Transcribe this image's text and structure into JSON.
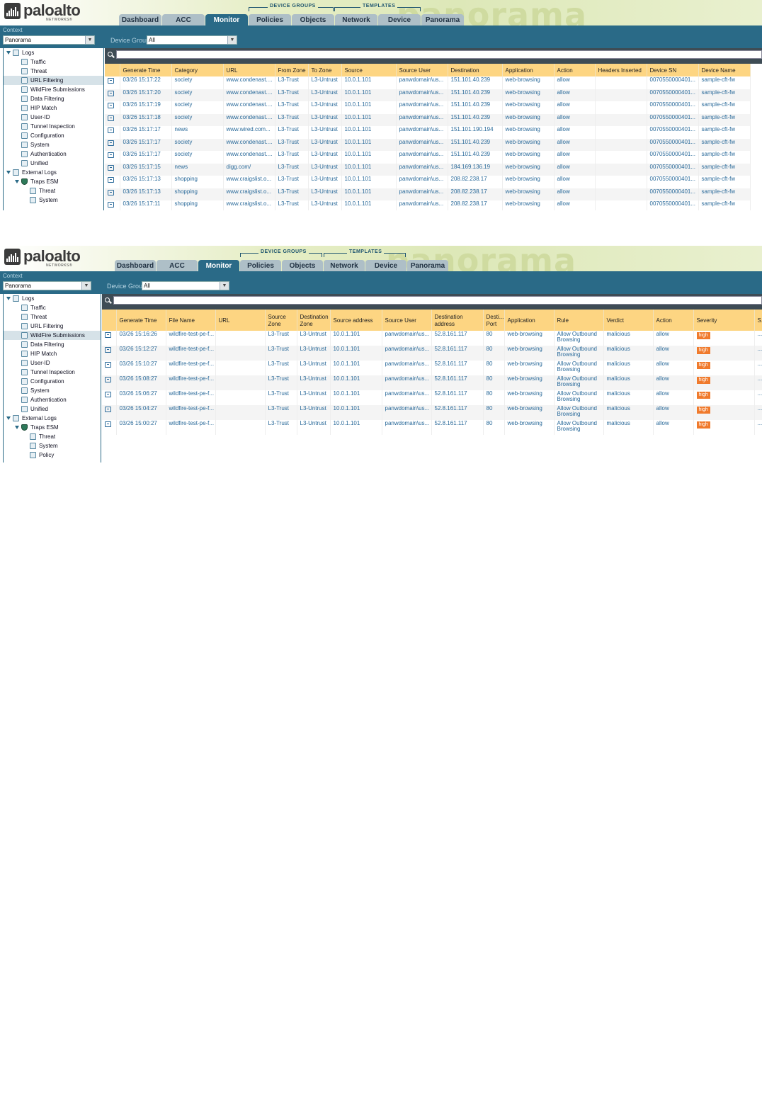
{
  "brand": {
    "name": "paloalto",
    "sub": "NETWORKS®"
  },
  "watermark": "panorama",
  "tab_groups": {
    "device_groups": "DEVICE GROUPS",
    "templates": "TEMPLATES"
  },
  "tabs": [
    "Dashboard",
    "ACC",
    "Monitor",
    "Policies",
    "Objects",
    "Network",
    "Device",
    "Panorama"
  ],
  "context": {
    "label": "Context",
    "value": "Panorama"
  },
  "device_group": {
    "label": "Device Group",
    "value": "All"
  },
  "panel1": {
    "sidebar": [
      {
        "label": "Logs",
        "level": 0,
        "expand": true
      },
      {
        "label": "Traffic",
        "level": 1
      },
      {
        "label": "Threat",
        "level": 1
      },
      {
        "label": "URL Filtering",
        "level": 1,
        "selected": true
      },
      {
        "label": "WildFire Submissions",
        "level": 1
      },
      {
        "label": "Data Filtering",
        "level": 1
      },
      {
        "label": "HIP Match",
        "level": 1
      },
      {
        "label": "User-ID",
        "level": 1
      },
      {
        "label": "Tunnel Inspection",
        "level": 1
      },
      {
        "label": "Configuration",
        "level": 1
      },
      {
        "label": "System",
        "level": 1
      },
      {
        "label": "Authentication",
        "level": 1
      },
      {
        "label": "Unified",
        "level": 1
      },
      {
        "label": "External Logs",
        "level": 0,
        "expand": true
      },
      {
        "label": "Traps ESM",
        "level": 1,
        "expand": true,
        "shield": true
      },
      {
        "label": "Threat",
        "level": 2
      },
      {
        "label": "System",
        "level": 2
      }
    ],
    "columns": [
      "",
      "Generate Time",
      "Category",
      "URL",
      "From Zone",
      "To Zone",
      "Source",
      "Source User",
      "Destination",
      "Application",
      "Action",
      "Headers Inserted",
      "Device SN",
      "Device Name"
    ],
    "rows": [
      [
        "03/26 15:17:22",
        "society",
        "www.condenast....",
        "L3-Trust",
        "L3-Untrust",
        "10.0.1.101",
        "panwdomain\\us...",
        "151.101.40.239",
        "web-browsing",
        "allow",
        "",
        "0070550000401...",
        "sample-cft-fw"
      ],
      [
        "03/26 15:17:20",
        "society",
        "www.condenast....",
        "L3-Trust",
        "L3-Untrust",
        "10.0.1.101",
        "panwdomain\\us...",
        "151.101.40.239",
        "web-browsing",
        "allow",
        "",
        "0070550000401...",
        "sample-cft-fw"
      ],
      [
        "03/26 15:17:19",
        "society",
        "www.condenast....",
        "L3-Trust",
        "L3-Untrust",
        "10.0.1.101",
        "panwdomain\\us...",
        "151.101.40.239",
        "web-browsing",
        "allow",
        "",
        "0070550000401...",
        "sample-cft-fw"
      ],
      [
        "03/26 15:17:18",
        "society",
        "www.condenast....",
        "L3-Trust",
        "L3-Untrust",
        "10.0.1.101",
        "panwdomain\\us...",
        "151.101.40.239",
        "web-browsing",
        "allow",
        "",
        "0070550000401...",
        "sample-cft-fw"
      ],
      [
        "03/26 15:17:17",
        "news",
        "www.wired.com...",
        "L3-Trust",
        "L3-Untrust",
        "10.0.1.101",
        "panwdomain\\us...",
        "151.101.190.194",
        "web-browsing",
        "allow",
        "",
        "0070550000401...",
        "sample-cft-fw"
      ],
      [
        "03/26 15:17:17",
        "society",
        "www.condenast....",
        "L3-Trust",
        "L3-Untrust",
        "10.0.1.101",
        "panwdomain\\us...",
        "151.101.40.239",
        "web-browsing",
        "allow",
        "",
        "0070550000401...",
        "sample-cft-fw"
      ],
      [
        "03/26 15:17:17",
        "society",
        "www.condenast....",
        "L3-Trust",
        "L3-Untrust",
        "10.0.1.101",
        "panwdomain\\us...",
        "151.101.40.239",
        "web-browsing",
        "allow",
        "",
        "0070550000401...",
        "sample-cft-fw"
      ],
      [
        "03/26 15:17:15",
        "news",
        "digg.com/",
        "L3-Trust",
        "L3-Untrust",
        "10.0.1.101",
        "panwdomain\\us...",
        "184.169.136.19",
        "web-browsing",
        "allow",
        "",
        "0070550000401...",
        "sample-cft-fw"
      ],
      [
        "03/26 15:17:13",
        "shopping",
        "www.craigslist.o...",
        "L3-Trust",
        "L3-Untrust",
        "10.0.1.101",
        "panwdomain\\us...",
        "208.82.238.17",
        "web-browsing",
        "allow",
        "",
        "0070550000401...",
        "sample-cft-fw"
      ],
      [
        "03/26 15:17:13",
        "shopping",
        "www.craigslist.o...",
        "L3-Trust",
        "L3-Untrust",
        "10.0.1.101",
        "panwdomain\\us...",
        "208.82.238.17",
        "web-browsing",
        "allow",
        "",
        "0070550000401...",
        "sample-cft-fw"
      ],
      [
        "03/26 15:17:11",
        "shopping",
        "www.craigslist.o...",
        "L3-Trust",
        "L3-Untrust",
        "10.0.1.101",
        "panwdomain\\us...",
        "208.82.238.17",
        "web-browsing",
        "allow",
        "",
        "0070550000401...",
        "sample-cft-fw"
      ]
    ]
  },
  "panel2": {
    "sidebar": [
      {
        "label": "Logs",
        "level": 0,
        "expand": true
      },
      {
        "label": "Traffic",
        "level": 1
      },
      {
        "label": "Threat",
        "level": 1
      },
      {
        "label": "URL Filtering",
        "level": 1
      },
      {
        "label": "WildFire Submissions",
        "level": 1,
        "selected": true
      },
      {
        "label": "Data Filtering",
        "level": 1
      },
      {
        "label": "HIP Match",
        "level": 1
      },
      {
        "label": "User-ID",
        "level": 1
      },
      {
        "label": "Tunnel Inspection",
        "level": 1
      },
      {
        "label": "Configuration",
        "level": 1
      },
      {
        "label": "System",
        "level": 1
      },
      {
        "label": "Authentication",
        "level": 1
      },
      {
        "label": "Unified",
        "level": 1
      },
      {
        "label": "External Logs",
        "level": 0,
        "expand": true
      },
      {
        "label": "Traps ESM",
        "level": 1,
        "expand": true,
        "shield": true
      },
      {
        "label": "Threat",
        "level": 2
      },
      {
        "label": "System",
        "level": 2
      },
      {
        "label": "Policy",
        "level": 2
      }
    ],
    "columns": [
      "",
      "Generate Time",
      "File Name",
      "URL",
      "Source Zone",
      "Destination Zone",
      "Source address",
      "Source User",
      "Destination address",
      "Desti... Port",
      "Application",
      "Rule",
      "Verdict",
      "Action",
      "Severity",
      "S..."
    ],
    "rows": [
      [
        "03/26 15:16:26",
        "wildfire-test-pe-f...",
        "",
        "L3-Trust",
        "L3-Untrust",
        "10.0.1.101",
        "panwdomain\\us...",
        "52.8.161.117",
        "80",
        "web-browsing",
        "Allow Outbound Browsing",
        "malicious",
        "allow",
        "high",
        "..."
      ],
      [
        "03/26 15:12:27",
        "wildfire-test-pe-f...",
        "",
        "L3-Trust",
        "L3-Untrust",
        "10.0.1.101",
        "panwdomain\\us...",
        "52.8.161.117",
        "80",
        "web-browsing",
        "Allow Outbound Browsing",
        "malicious",
        "allow",
        "high",
        "..."
      ],
      [
        "03/26 15:10:27",
        "wildfire-test-pe-f...",
        "",
        "L3-Trust",
        "L3-Untrust",
        "10.0.1.101",
        "panwdomain\\us...",
        "52.8.161.117",
        "80",
        "web-browsing",
        "Allow Outbound Browsing",
        "malicious",
        "allow",
        "high",
        "..."
      ],
      [
        "03/26 15:08:27",
        "wildfire-test-pe-f...",
        "",
        "L3-Trust",
        "L3-Untrust",
        "10.0.1.101",
        "panwdomain\\us...",
        "52.8.161.117",
        "80",
        "web-browsing",
        "Allow Outbound Browsing",
        "malicious",
        "allow",
        "high",
        "..."
      ],
      [
        "03/26 15:06:27",
        "wildfire-test-pe-f...",
        "",
        "L3-Trust",
        "L3-Untrust",
        "10.0.1.101",
        "panwdomain\\us...",
        "52.8.161.117",
        "80",
        "web-browsing",
        "Allow Outbound Browsing",
        "malicious",
        "allow",
        "high",
        "..."
      ],
      [
        "03/26 15:04:27",
        "wildfire-test-pe-f...",
        "",
        "L3-Trust",
        "L3-Untrust",
        "10.0.1.101",
        "panwdomain\\us...",
        "52.8.161.117",
        "80",
        "web-browsing",
        "Allow Outbound Browsing",
        "malicious",
        "allow",
        "high",
        "..."
      ],
      [
        "03/26 15:00:27",
        "wildfire-test-pe-f...",
        "",
        "L3-Trust",
        "L3-Untrust",
        "10.0.1.101",
        "panwdomain\\us...",
        "52.8.161.117",
        "80",
        "web-browsing",
        "Allow Outbound Browsing",
        "malicious",
        "allow",
        "high",
        "..."
      ]
    ]
  },
  "colors": {
    "accent": "#2a6a87",
    "header_row": "#fdd582",
    "link": "#2a6a9a",
    "severity_high": "#f07a2c"
  },
  "icons": {
    "search": "search-icon",
    "log_detail": "log-detail-icon",
    "tree_node": "log-type-icon",
    "traps": "shield-icon"
  }
}
